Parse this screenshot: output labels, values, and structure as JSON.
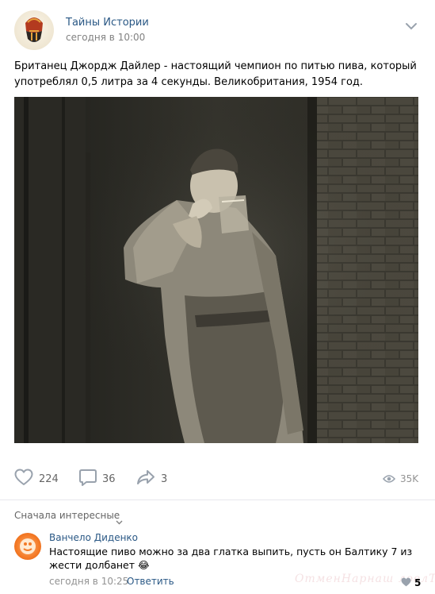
{
  "post": {
    "author": "Тайны Истории",
    "time": "сегодня в 10:00",
    "text": "Британец Джордж Дайлер - настоящий чемпион по питью пива, который употреблял 0,5 литра за 4 секунды. Великобритания, 1954 год."
  },
  "actions": {
    "likes": "224",
    "comments": "36",
    "shares": "3",
    "views": "35K"
  },
  "comments_section": {
    "sort_label": "Сначала интересные"
  },
  "comment": {
    "author": "Ванчело Диденко",
    "text": "Настоящие пиво можно за два глатка выпить, пусть он Балтику 7 из жести долбанет 😂",
    "time": "сегодня в 10:25",
    "reply_label": "Ответить",
    "likes": "5"
  },
  "watermark": "ОтменНарнаш ловлТВ",
  "colors": {
    "link": "#2a5885",
    "muted": "#828282",
    "icon": "#99a2ad"
  }
}
